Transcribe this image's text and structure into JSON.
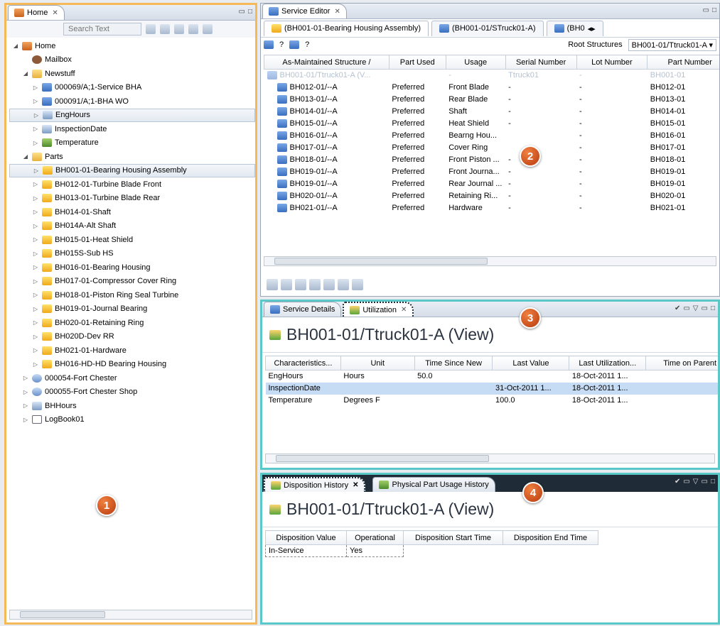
{
  "left_view": {
    "tab_title": "Home",
    "search_placeholder": "Search Text",
    "tree": [
      {
        "label": "Home",
        "level": 0,
        "icon": "home",
        "expand": "open"
      },
      {
        "label": "Mailbox",
        "level": 1,
        "icon": "mail",
        "expand": "none"
      },
      {
        "label": "Newstuff",
        "level": 1,
        "icon": "folder",
        "expand": "open"
      },
      {
        "label": "000069/A;1-Service BHA",
        "level": 2,
        "icon": "struct",
        "expand": "closed"
      },
      {
        "label": "000091/A;1-BHA WO",
        "level": 2,
        "icon": "struct",
        "expand": "closed"
      },
      {
        "label": "EngHours",
        "level": 2,
        "icon": "edit",
        "expand": "closed",
        "selected": true
      },
      {
        "label": "InspectionDate",
        "level": 2,
        "icon": "edit",
        "expand": "closed"
      },
      {
        "label": "Temperature",
        "level": 2,
        "icon": "chart",
        "expand": "closed"
      },
      {
        "label": "Parts",
        "level": 1,
        "icon": "folder",
        "expand": "open"
      },
      {
        "label": "BH001-01-Bearing Housing Assembly",
        "level": 2,
        "icon": "yellow",
        "expand": "closed",
        "selected": true
      },
      {
        "label": "BH012-01-Turbine Blade Front",
        "level": 2,
        "icon": "yellow",
        "expand": "closed"
      },
      {
        "label": "BH013-01-Turbine Blade Rear",
        "level": 2,
        "icon": "yellow",
        "expand": "closed"
      },
      {
        "label": "BH014-01-Shaft",
        "level": 2,
        "icon": "yellow",
        "expand": "closed"
      },
      {
        "label": "BH014A-Alt Shaft",
        "level": 2,
        "icon": "yellow",
        "expand": "closed"
      },
      {
        "label": "BH015-01-Heat Shield",
        "level": 2,
        "icon": "yellow",
        "expand": "closed"
      },
      {
        "label": "BH015S-Sub HS",
        "level": 2,
        "icon": "yellow",
        "expand": "closed"
      },
      {
        "label": "BH016-01-Bearing Housing",
        "level": 2,
        "icon": "yellow",
        "expand": "closed"
      },
      {
        "label": "BH017-01-Compressor Cover Ring",
        "level": 2,
        "icon": "yellow",
        "expand": "closed"
      },
      {
        "label": "BH018-01-Piston Ring Seal Turbine",
        "level": 2,
        "icon": "yellow",
        "expand": "closed"
      },
      {
        "label": "BH019-01-Journal Bearing",
        "level": 2,
        "icon": "yellow",
        "expand": "closed"
      },
      {
        "label": "BH020-01-Retaining Ring",
        "level": 2,
        "icon": "yellow",
        "expand": "closed"
      },
      {
        "label": "BH020D-Dev RR",
        "level": 2,
        "icon": "yellow",
        "expand": "closed"
      },
      {
        "label": "BH021-01-Hardware",
        "level": 2,
        "icon": "yellow",
        "expand": "closed"
      },
      {
        "label": "BH016-HD-HD Bearing Housing",
        "level": 2,
        "icon": "yellow",
        "expand": "closed"
      },
      {
        "label": "000054-Fort Chester",
        "level": 1,
        "icon": "site",
        "expand": "closed"
      },
      {
        "label": "000055-Fort Chester Shop",
        "level": 1,
        "icon": "site",
        "expand": "closed"
      },
      {
        "label": "BHHours",
        "level": 1,
        "icon": "edit",
        "expand": "closed"
      },
      {
        "label": "LogBook01",
        "level": 1,
        "icon": "log",
        "expand": "closed"
      }
    ],
    "callout": "1"
  },
  "editor": {
    "tab_title": "Service Editor",
    "subtabs": [
      "(BH001-01-Bearing Housing Assembly)",
      "(BH001-01/STruck01-A)",
      "(BH0"
    ],
    "toolbar_marks": [
      "?",
      "?"
    ],
    "root_label": "Root Structures",
    "root_value": "BH001-01/Ttruck01-A",
    "columns": [
      "As-Maintained Structure /",
      "Part Used",
      "Usage",
      "Serial Number",
      "Lot Number",
      "Part Number"
    ],
    "ghost_row": [
      "BH001-01/Ttruck01-A (V...",
      "",
      "-",
      "Ttruck01",
      "-",
      "BH001-01"
    ],
    "rows": [
      [
        "BH012-01/--A",
        "Preferred",
        "Front Blade",
        "-",
        "-",
        "BH012-01"
      ],
      [
        "BH013-01/--A",
        "Preferred",
        "Rear Blade",
        "-",
        "-",
        "BH013-01"
      ],
      [
        "BH014-01/--A",
        "Preferred",
        "Shaft",
        "-",
        "-",
        "BH014-01"
      ],
      [
        "BH015-01/--A",
        "Preferred",
        "Heat Shield",
        "-",
        "-",
        "BH015-01"
      ],
      [
        "BH016-01/--A",
        "Preferred",
        "Bearng Hou...",
        "",
        "-",
        "BH016-01"
      ],
      [
        "BH017-01/--A",
        "Preferred",
        "Cover Ring",
        "",
        "-",
        "BH017-01"
      ],
      [
        "BH018-01/--A",
        "Preferred",
        "Front Piston ...",
        "-",
        "-",
        "BH018-01"
      ],
      [
        "BH019-01/--A",
        "Preferred",
        "Front Journa...",
        "-",
        "-",
        "BH019-01"
      ],
      [
        "BH019-01/--A",
        "Preferred",
        "Rear Journal ...",
        "-",
        "-",
        "BH019-01"
      ],
      [
        "BH020-01/--A",
        "Preferred",
        "Retaining Ri...",
        "-",
        "-",
        "BH020-01"
      ],
      [
        "BH021-01/--A",
        "Preferred",
        "Hardware",
        "-",
        "-",
        "BH021-01"
      ]
    ],
    "callout": "2"
  },
  "utilization": {
    "tabs": [
      "Service Details",
      "Utilization"
    ],
    "title": "BH001-01/Ttruck01-A (View)",
    "columns": [
      "Characteristics...",
      "Unit",
      "Time Since New",
      "Last Value",
      "Last Utilization...",
      "Time on Parent"
    ],
    "rows": [
      [
        "EngHours",
        "Hours",
        "50.0",
        "",
        "18-Oct-2011 1...",
        ""
      ],
      [
        "InspectionDate",
        "",
        "",
        "31-Oct-2011 1...",
        "18-Oct-2011 1...",
        ""
      ],
      [
        "Temperature",
        "Degrees F",
        "",
        "100.0",
        "18-Oct-2011 1...",
        ""
      ]
    ],
    "selected_row": 1,
    "callout": "3"
  },
  "disposition": {
    "tabs": [
      "Disposition History",
      "Physical Part Usage History"
    ],
    "title": "BH001-01/Ttruck01-A (View)",
    "columns": [
      "Disposition Value",
      "Operational",
      "Disposition Start Time",
      "Disposition End Time"
    ],
    "rows": [
      [
        "In-Service",
        "Yes",
        "",
        ""
      ]
    ],
    "callout": "4"
  }
}
